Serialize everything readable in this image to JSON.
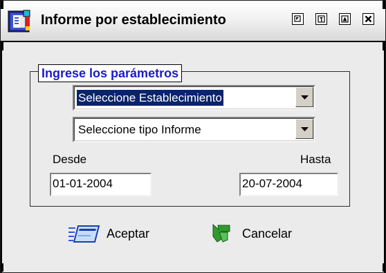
{
  "window": {
    "title": "Informe por establecimiento",
    "title_icon": "report-book-icon",
    "title_buttons": [
      {
        "name": "restore-icon"
      },
      {
        "name": "filter-icon"
      },
      {
        "name": "maximize-icon"
      },
      {
        "name": "close-icon"
      }
    ]
  },
  "form": {
    "group_title": "Ingrese los parámetros",
    "establecimiento_select": "Seleccione Establecimiento",
    "tipo_informe_select": "Seleccione tipo Informe",
    "desde_label": "Desde",
    "desde_value": "01-01-2004",
    "hasta_label": "Hasta",
    "hasta_value": "20-07-2004"
  },
  "actions": {
    "accept_label": "Aceptar",
    "accept_icon": "card-accept-icon",
    "cancel_label": "Cancelar",
    "cancel_icon": "green-arrow-cancel-icon"
  },
  "colors": {
    "group_title": "#1b1bc8",
    "selection_bg": "#0a246a",
    "window_bg": "#ebebeb"
  }
}
